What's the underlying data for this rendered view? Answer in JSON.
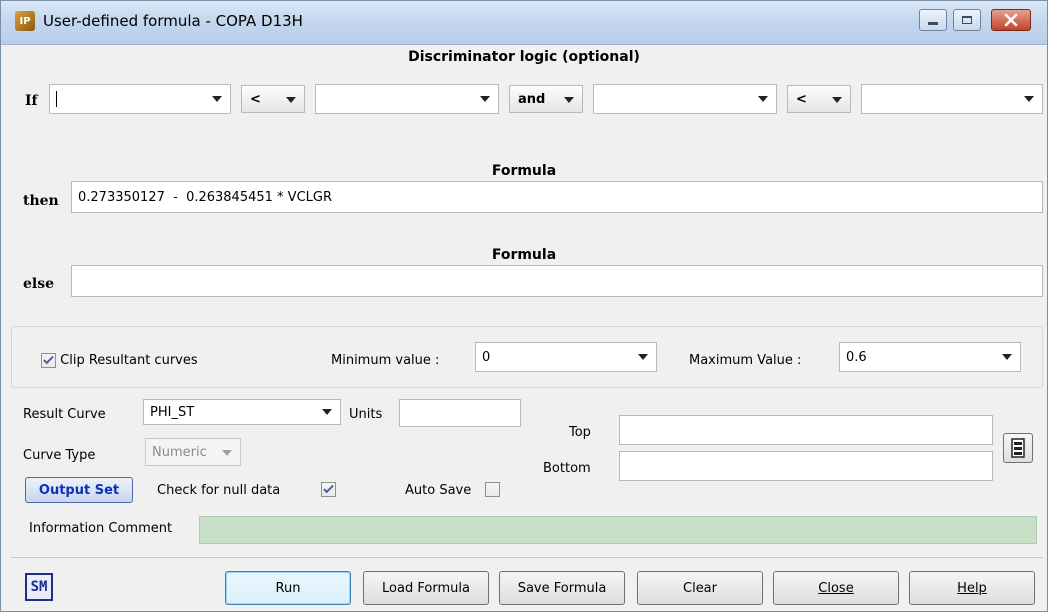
{
  "window": {
    "title": "User-defined formula - COPA D13H",
    "app_icon_text": "IP"
  },
  "discriminator": {
    "header": "Discriminator logic (optional)",
    "if_label": "If",
    "field1_value": "",
    "op1": "<",
    "field2_value": "",
    "conjunction": "and",
    "field3_value": "",
    "op2": "<",
    "field4_value": ""
  },
  "then": {
    "header": "Formula",
    "label": "then",
    "formula": "0.273350127  -  0.263845451 * VCLGR"
  },
  "else": {
    "header": "Formula",
    "label": "else",
    "formula": ""
  },
  "clip": {
    "checkbox_label": "Clip Resultant curves",
    "checked": true,
    "min_label": "Minimum value :",
    "min_value": "0",
    "max_label": "Maximum Value :",
    "max_value": "0.6"
  },
  "result": {
    "curve_label": "Result Curve",
    "curve_value": "PHI_ST",
    "units_label": "Units",
    "units_value": "",
    "type_label": "Curve Type",
    "type_value": "Numeric",
    "top_label": "Top",
    "top_value": "",
    "bottom_label": "Bottom",
    "bottom_value": ""
  },
  "options": {
    "output_set_label": "Output Set",
    "null_check_label": "Check for null data",
    "null_check_checked": true,
    "auto_save_label": "Auto Save",
    "auto_save_checked": false
  },
  "info": {
    "label": "Information Comment",
    "value": ""
  },
  "footer": {
    "sm_badge": "SM",
    "run_label": "Run",
    "load_label": "Load Formula",
    "save_label": "Save Formula",
    "clear_label": "Clear",
    "close_label": "Close",
    "help_label": "Help"
  }
}
